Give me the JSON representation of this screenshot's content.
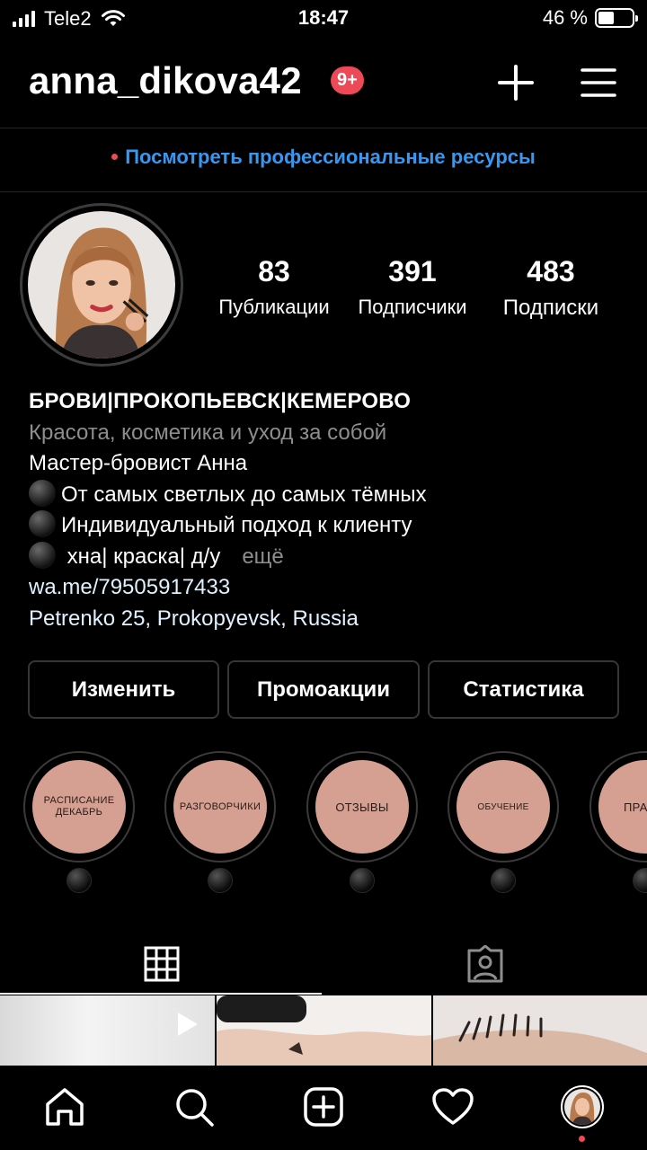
{
  "status_bar": {
    "carrier": "Tele2",
    "time": "18:47",
    "battery_text": "46 %",
    "battery_level": 0.46
  },
  "header": {
    "username": "anna_dikova42",
    "notification_badge": "9+",
    "icons": [
      "plus-icon",
      "hamburger-menu-icon"
    ]
  },
  "pro_banner": {
    "text": "Посмотреть профессиональные ресурсы"
  },
  "stats": [
    {
      "value": "83",
      "label": "Публикации"
    },
    {
      "value": "391",
      "label": "Подписчики"
    },
    {
      "value": "483",
      "label": "Подписки"
    }
  ],
  "bio": {
    "name": "БРОВИ|ПРОКОПЬЕВСК|КЕМЕРОВО",
    "category": "Красота, косметика и уход за собой",
    "line1": "Мастер-бровист Анна",
    "line2": "От самых светлых до самых тёмных",
    "line3": "Индивидуальный подход к клиенту",
    "line4": " хна| краска| д/у",
    "more": "ещё",
    "link": "wa.me/79505917433",
    "address": "Petrenko 25, Prokopyevsk, Russia"
  },
  "buttons": {
    "edit": "Изменить",
    "promo": "Промоакции",
    "stats": "Статистика"
  },
  "highlights": [
    {
      "label": "РАСПИСАНИЕ ДЕКАБРЬ"
    },
    {
      "label": "РАЗГОВОРЧИКИ"
    },
    {
      "label": "ОТЗЫВЫ"
    },
    {
      "label": "ОБУЧЕНИЕ"
    },
    {
      "label": "ПРА"
    }
  ],
  "tabs": {
    "active": "grid",
    "icons": [
      "grid-icon",
      "tagged-person-icon"
    ]
  },
  "bottom_nav": {
    "icons": [
      "home-icon",
      "search-icon",
      "new-post-icon",
      "heart-icon",
      "profile-avatar"
    ]
  },
  "colors": {
    "background": "#000000",
    "accent_link": "#3897f0",
    "badge_red": "#ed4956",
    "highlight_cover": "#d5a092",
    "secondary_text": "#8e8e8e"
  }
}
